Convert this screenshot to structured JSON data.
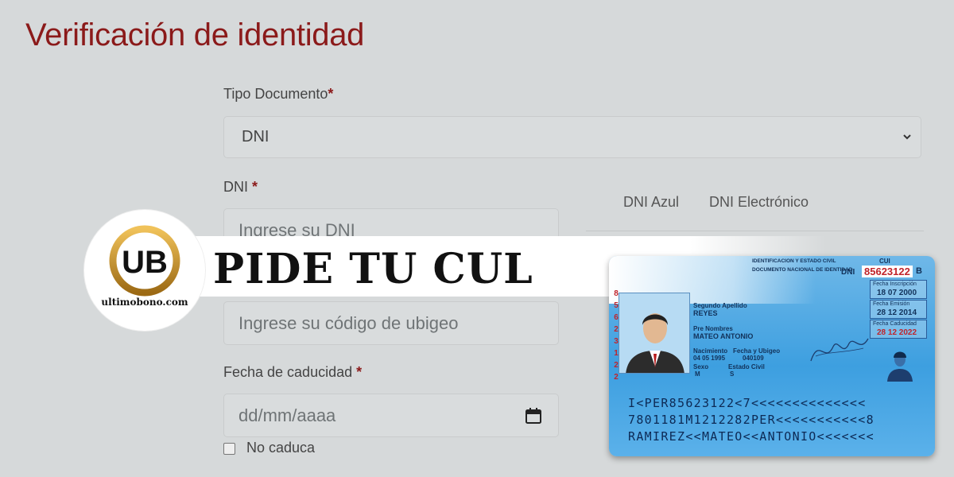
{
  "page": {
    "title": "Verificación de identidad"
  },
  "form": {
    "tipo_documento": {
      "label": "Tipo Documento",
      "required_mark": "*",
      "value": "DNI"
    },
    "dni": {
      "label": "DNI",
      "required_mark": "*",
      "placeholder": "Ingrese su DNI"
    },
    "ubigeo": {
      "placeholder": "Ingrese su código de ubigeo"
    },
    "fecha_caducidad": {
      "label": "Fecha de caducidad",
      "required_mark": "*",
      "placeholder": "dd/mm/aaaa"
    },
    "no_caduca": {
      "label": "No caduca",
      "checked": false
    }
  },
  "tabs": [
    {
      "label": "DNI Azul"
    },
    {
      "label": "DNI Electrónico"
    }
  ],
  "banner": {
    "text": "PIDE TU CUL",
    "logo_letters": "UB",
    "logo_url": "ultimobono.com"
  },
  "id_card": {
    "header_line1": "IDENTIFICACION Y ESTADO CIVIL",
    "header_line2": "DOCUMENTO NACIONAL DE IDENTIDAD",
    "cui_label": "CUI",
    "dni_label": "DNI",
    "dni_number": "85623122",
    "check_letter": "B",
    "vertical_number": "85623122",
    "segundo_apellido_label": "Segundo Apellido",
    "segundo_apellido": "REYES",
    "prenombres_label": "Pre Nombres",
    "prenombres": "MATEO ANTONIO",
    "nacimiento_label": "Nacimiento",
    "nacimiento_value": "04 05 1995",
    "ubigeo_label": "Fecha y Ubigeo",
    "ubigeo_value": "040109",
    "sexo_label": "Sexo",
    "sexo_value": "M",
    "estado_civil_label": "Estado Civil",
    "estado_civil_value": "S",
    "fecha_inscripcion_label": "Fecha Inscripción",
    "fecha_inscripcion": "18 07 2000",
    "fecha_emision_label": "Fecha Emisión",
    "fecha_emision": "28 12 2014",
    "fecha_caducidad_label": "Fecha Caducidad",
    "fecha_caducidad": "28 12 2022",
    "mrz_line1": "I<PER85623122<7<<<<<<<<<<<<<<",
    "mrz_line2": "7801181M1212282PER<<<<<<<<<<<8",
    "mrz_line3": "RAMIREZ<<MATEO<<ANTONIO<<<<<<<"
  },
  "colors": {
    "background": "#d6d9da",
    "title": "#8b1a1a",
    "required": "#8b1a1a",
    "logo_gold": "#c9962e",
    "card_blue": "#3d9fe0",
    "mrz_ink": "#0d2a55"
  }
}
